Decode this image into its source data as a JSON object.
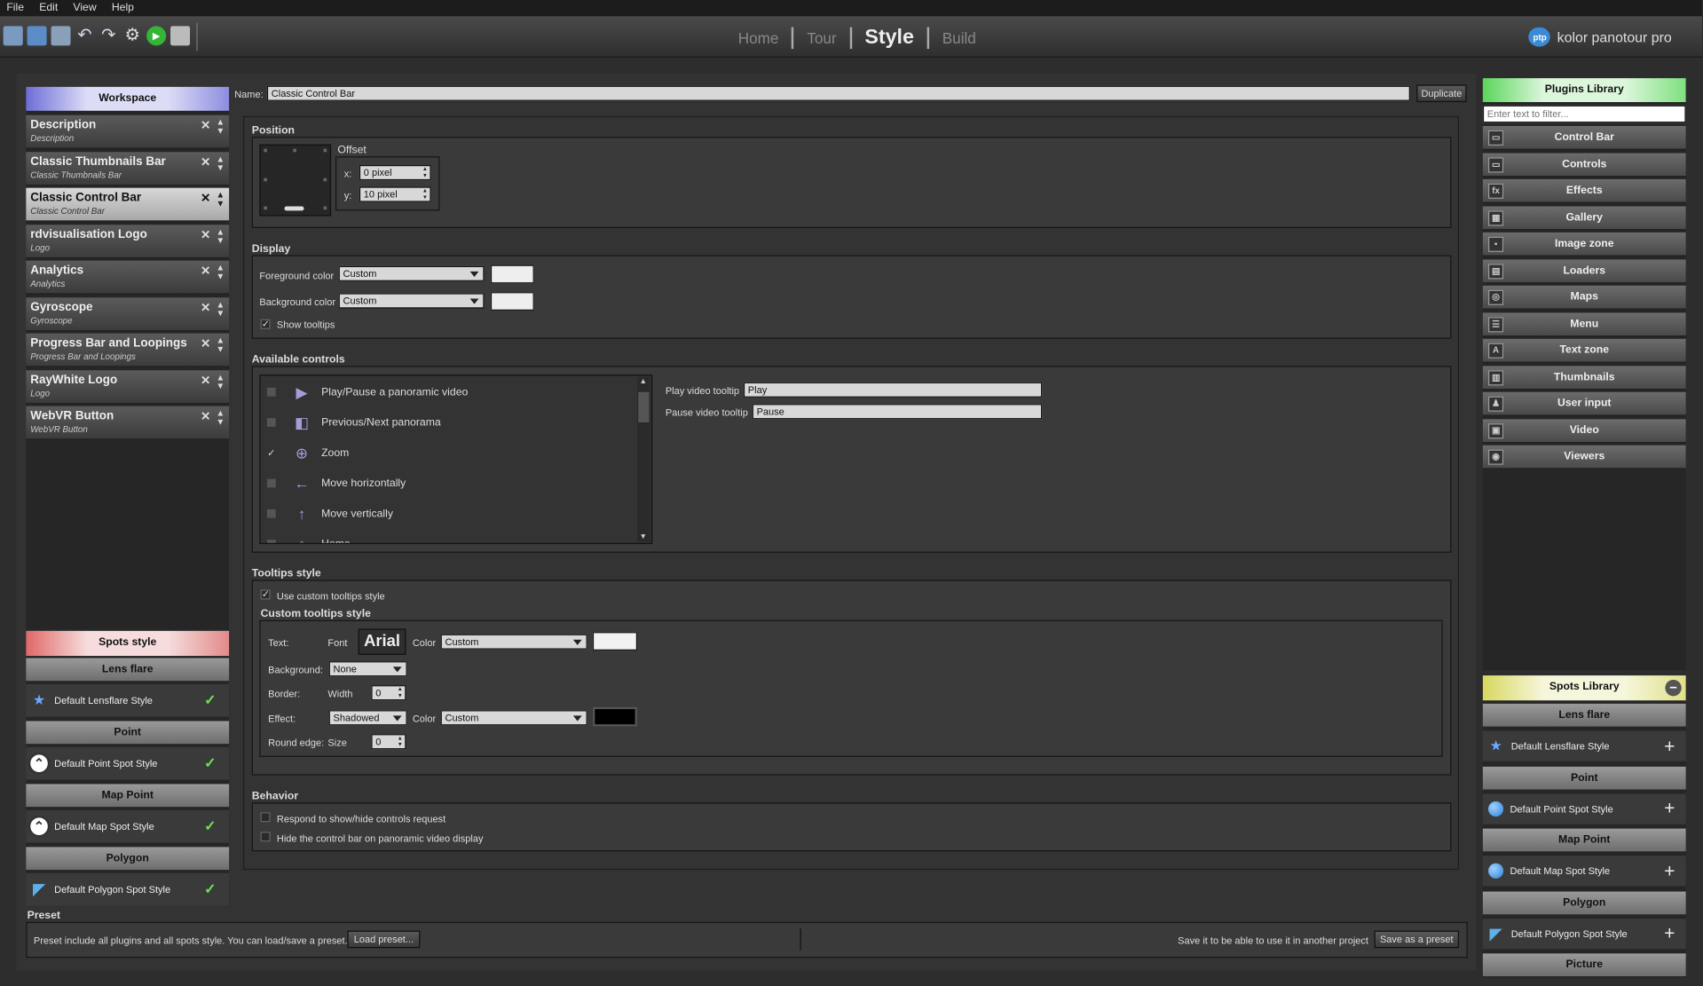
{
  "menu": [
    "File",
    "Edit",
    "View",
    "Help"
  ],
  "nav": {
    "tabs": [
      "Home",
      "Tour",
      "Style",
      "Build"
    ],
    "active": "Style"
  },
  "brand": {
    "logo": "ptp",
    "name": "kolor panotour pro"
  },
  "workspace": {
    "title": "Workspace",
    "items": [
      {
        "title": "Description",
        "sub": "Description"
      },
      {
        "title": "Classic Thumbnails Bar",
        "sub": "Classic Thumbnails Bar"
      },
      {
        "title": "Classic Control Bar",
        "sub": "Classic Control Bar",
        "selected": true
      },
      {
        "title": "rdvisualisation Logo",
        "sub": "Logo"
      },
      {
        "title": "Analytics",
        "sub": "Analytics"
      },
      {
        "title": "Gyroscope",
        "sub": "Gyroscope"
      },
      {
        "title": "Progress Bar and Loopings",
        "sub": "Progress Bar and Loopings"
      },
      {
        "title": "RayWhite Logo",
        "sub": "Logo"
      },
      {
        "title": "WebVR Button",
        "sub": "WebVR Button"
      }
    ]
  },
  "spots_style": {
    "title": "Spots style",
    "groups": [
      {
        "header": "Lens flare",
        "item": "Default Lensflare Style",
        "icon": "star-icon"
      },
      {
        "header": "Point",
        "item": "Default Point Spot Style",
        "icon": "point-spot-icon"
      },
      {
        "header": "Map Point",
        "item": "Default Map Spot Style",
        "icon": "map-spot-icon"
      },
      {
        "header": "Polygon",
        "item": "Default Polygon Spot Style",
        "icon": "polygon-icon"
      }
    ]
  },
  "editor": {
    "name_label": "Name:",
    "name_value": "Classic Control Bar",
    "duplicate": "Duplicate",
    "position": {
      "title": "Position",
      "offset": "Offset",
      "x_label": "x:",
      "x_value": "0 pixel",
      "y_label": "y:",
      "y_value": "10 pixel"
    },
    "display": {
      "title": "Display",
      "fg_label": "Foreground color",
      "fg_value": "Custom",
      "bg_label": "Background color",
      "bg_value": "Custom",
      "tooltips": "Show tooltips"
    },
    "available": {
      "title": "Available controls",
      "controls": [
        {
          "label": "Play/Pause a panoramic video",
          "checked": false,
          "icon": "play-icon"
        },
        {
          "label": "Previous/Next panorama",
          "checked": false,
          "icon": "prev-next-icon"
        },
        {
          "label": "Zoom",
          "checked": true,
          "icon": "zoom-icon"
        },
        {
          "label": "Move horizontally",
          "checked": false,
          "icon": "arrow-left-icon"
        },
        {
          "label": "Move vertically",
          "checked": false,
          "icon": "arrow-up-icon"
        },
        {
          "label": "Home",
          "checked": false,
          "icon": "home-icon"
        }
      ],
      "play_label": "Play video tooltip",
      "play_value": "Play",
      "pause_label": "Pause video tooltip",
      "pause_value": "Pause"
    },
    "tooltips_style": {
      "title": "Tooltips style",
      "use_custom": "Use custom tooltips style",
      "custom_title": "Custom tooltips style",
      "text_label": "Text:",
      "font_label": "Font",
      "font_value": "Arial",
      "color_label": "Color",
      "text_color": "Custom",
      "background_label": "Background:",
      "background_value": "None",
      "border_label": "Border:",
      "width_label": "Width",
      "width_value": "0",
      "effect_label": "Effect:",
      "effect_value": "Shadowed",
      "effect_color": "Custom",
      "round_label": "Round edge:",
      "size_label": "Size",
      "size_value": "0"
    },
    "behavior": {
      "title": "Behavior",
      "opt1": "Respond to show/hide controls request",
      "opt2": "Hide the control bar on panoramic video display"
    }
  },
  "preset": {
    "title": "Preset",
    "info": "Preset include all plugins and all spots style. You can load/save a preset.",
    "load": "Load preset...",
    "save_info": "Save it to be able to use it in another project",
    "save": "Save as a preset"
  },
  "plugins": {
    "title": "Plugins Library",
    "filter_placeholder": "Enter text to filter...",
    "items": [
      "Control Bar",
      "Controls",
      "Effects",
      "Gallery",
      "Image zone",
      "Loaders",
      "Maps",
      "Menu",
      "Text zone",
      "Thumbnails",
      "User input",
      "Video",
      "Viewers"
    ]
  },
  "spots_library": {
    "title": "Spots Library",
    "groups": [
      {
        "header": "Lens flare",
        "item": "Default Lensflare Style"
      },
      {
        "header": "Point",
        "item": "Default Point Spot Style"
      },
      {
        "header": "Map Point",
        "item": "Default Map Spot Style"
      },
      {
        "header": "Polygon",
        "item": "Default Polygon Spot Style"
      }
    ],
    "last_header": "Picture"
  },
  "colors": {
    "accent_blue": "#6d6dd8",
    "accent_red": "#e06868",
    "accent_green": "#5bd65b",
    "accent_yellow": "#d8d860"
  }
}
